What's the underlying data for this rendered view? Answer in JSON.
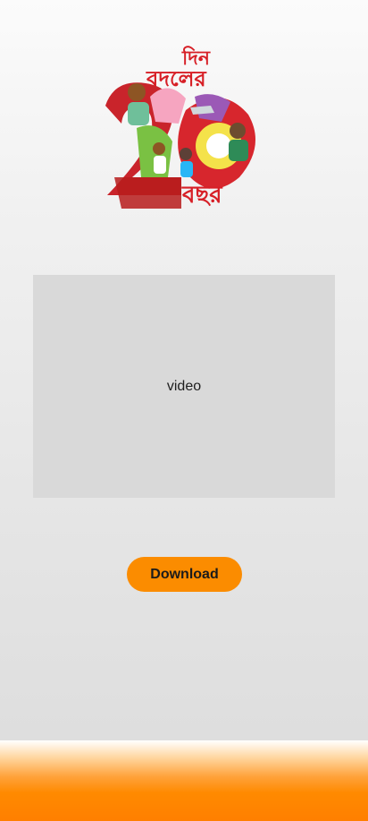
{
  "logo": {
    "text_line1": "দিন",
    "text_line2": "বদলের",
    "text_line3": "২০",
    "text_line4": "বছর"
  },
  "video": {
    "label": "video"
  },
  "download": {
    "label": "Download"
  },
  "colors": {
    "accent": "#fb8c00",
    "video_bg": "#d9d9d9",
    "logo_red": "#d71f26"
  }
}
